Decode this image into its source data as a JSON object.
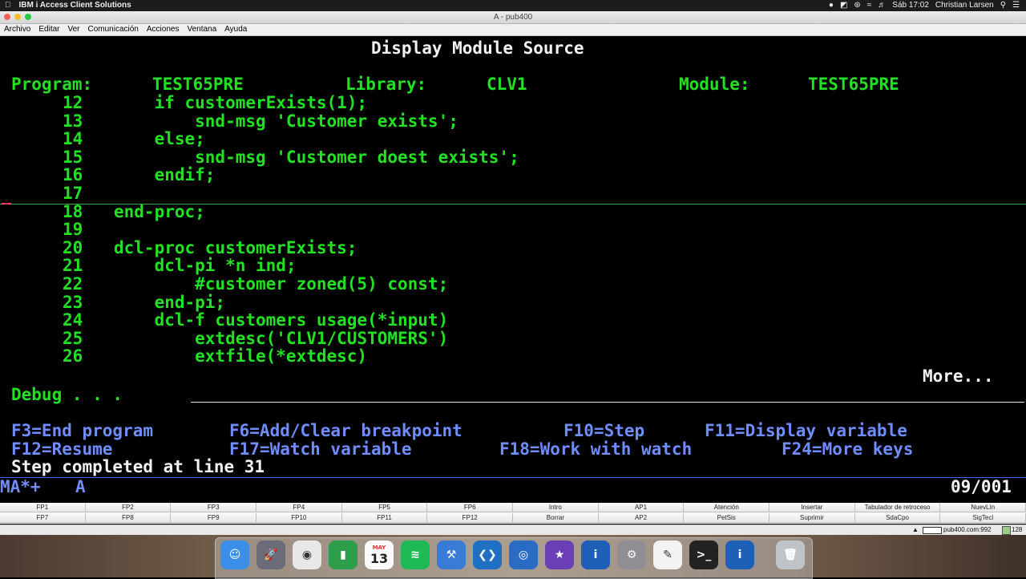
{
  "mac": {
    "app_name": "IBM i Access Client Solutions",
    "clock": "Sáb 17:02",
    "user": "Christian Larsen"
  },
  "window": {
    "title": "A - pub400"
  },
  "menu": [
    "Archivo",
    "Editar",
    "Ver",
    "Comunicación",
    "Acciones",
    "Ventana",
    "Ayuda"
  ],
  "screen": {
    "title": "Display Module Source",
    "program_label": "Program:",
    "program": "TEST65PRE",
    "library_label": "Library:",
    "library": "CLV1",
    "module_label": "Module:",
    "module": "TEST65PRE",
    "lines": [
      {
        "num": "12",
        "code": "    if customerExists(1);"
      },
      {
        "num": "13",
        "code": "        snd-msg 'Customer exists';"
      },
      {
        "num": "14",
        "code": "    else;"
      },
      {
        "num": "15",
        "code": "        snd-msg 'Customer doest exists';"
      },
      {
        "num": "16",
        "code": "    endif;"
      },
      {
        "num": "17",
        "code": ""
      },
      {
        "num": "18",
        "code": "end-proc;"
      },
      {
        "num": "19",
        "code": ""
      },
      {
        "num": "20",
        "code": "dcl-proc customerExists;"
      },
      {
        "num": "21",
        "code": "    dcl-pi *n ind;"
      },
      {
        "num": "22",
        "code": "        #customer zoned(5) const;"
      },
      {
        "num": "23",
        "code": "    end-pi;"
      },
      {
        "num": "24",
        "code": "    dcl-f customers usage(*input)"
      },
      {
        "num": "25",
        "code": "        extdesc('CLV1/CUSTOMERS')"
      },
      {
        "num": "26",
        "code": "        extfile(*extdesc)"
      }
    ],
    "more": "More...",
    "debug": "Debug . . .",
    "fkeys_row1": [
      "F3=End program",
      "F6=Add/Clear breakpoint",
      "F10=Step",
      "F11=Display variable"
    ],
    "fkeys_row2": [
      "F12=Resume",
      "F17=Watch variable",
      "F18=Work with watch",
      "F24=More keys"
    ],
    "message": "Step completed at line 31",
    "oia_left": "MA*+",
    "oia_mode": "A",
    "cursor_pos": "09/001"
  },
  "keypad": {
    "row1": [
      "FP1",
      "FP2",
      "FP3",
      "FP4",
      "FP5",
      "FP6",
      "Intro",
      "AP1",
      "Atención",
      "Insertar",
      "Tabulador de retroceso",
      "NuevLín"
    ],
    "row2": [
      "FP7",
      "FP8",
      "FP9",
      "FP10",
      "FP11",
      "FP12",
      "Borrar",
      "AP2",
      "PetSis",
      "Suprimir",
      "SdaCpo",
      "SigTecl"
    ]
  },
  "status": {
    "host": "pub400.com:992",
    "extra": "128"
  },
  "dock": [
    "finder",
    "launchpad",
    "chrome",
    "numbers",
    "calendar",
    "spotify",
    "xcode",
    "vscode",
    "ibm-i-acs",
    "imovie",
    "ibm-i",
    "system-preferences",
    "textedit",
    "terminal",
    "ibm-i-2",
    "trash"
  ],
  "calendar_day": "13",
  "calendar_month": "MAY",
  "colors": {
    "green": "#22e022",
    "white": "#f2f2f2",
    "blue": "#6f8dff"
  }
}
